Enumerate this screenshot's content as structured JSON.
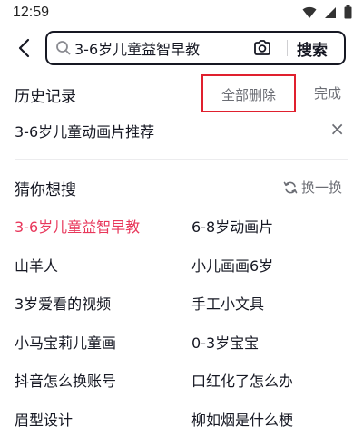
{
  "status": {
    "time": "12:59"
  },
  "search": {
    "query": "3-6岁儿童益智早教",
    "button_label": "搜索"
  },
  "history": {
    "title": "历史记录",
    "clear_all_label": "全部删除",
    "done_label": "完成",
    "items": [
      {
        "text": "3-6岁儿童动画片推荐",
        "remove_label": "×"
      }
    ]
  },
  "guess": {
    "title": "猜你想搜",
    "refresh_label": "换一换",
    "suggestions": [
      {
        "text": "3-6岁儿童益智早教",
        "highlight": true
      },
      {
        "text": "6-8岁动画片",
        "highlight": false
      },
      {
        "text": "山羊人",
        "highlight": false
      },
      {
        "text": "小儿画画6岁",
        "highlight": false
      },
      {
        "text": "3岁爱看的视频",
        "highlight": false
      },
      {
        "text": "手工小文具",
        "highlight": false
      },
      {
        "text": "小马宝莉儿童画",
        "highlight": false
      },
      {
        "text": "0-3岁宝宝",
        "highlight": false
      },
      {
        "text": "抖音怎么换账号",
        "highlight": false
      },
      {
        "text": "口红化了怎么办",
        "highlight": false
      },
      {
        "text": "眉型设计",
        "highlight": false
      },
      {
        "text": "柳如烟是什么梗",
        "highlight": false
      }
    ]
  },
  "colors": {
    "highlight": "#e8375b",
    "annotation_box": "#e0202e",
    "text": "#161823",
    "muted": "#6b6d74"
  },
  "icons": [
    "wifi-icon",
    "signal-icon",
    "battery-icon",
    "back-arrow-icon",
    "search-icon",
    "camera-search-icon",
    "close-icon",
    "refresh-icon"
  ]
}
